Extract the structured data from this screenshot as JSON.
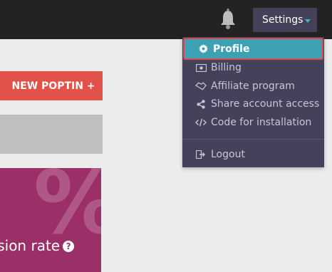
{
  "topbar": {
    "bell_icon": "bell-icon",
    "settings_label": "Settings",
    "accent": "#3bb6c9"
  },
  "dropdown": {
    "items": [
      {
        "label": "Profile",
        "icon": "gear-icon",
        "active": true
      },
      {
        "label": "Billing",
        "icon": "billing-icon"
      },
      {
        "label": "Affiliate program",
        "icon": "handshake-icon"
      },
      {
        "label": "Share account access",
        "icon": "share-icon"
      },
      {
        "label": "Code for installation",
        "icon": "code-icon"
      },
      {
        "label": "Logout",
        "icon": "logout-icon"
      }
    ],
    "highlight_color": "#e0474c"
  },
  "main": {
    "new_poptin_label": "NEW POPTIN +",
    "card": {
      "symbol": "%",
      "label": "rsion rate",
      "help_icon": "?",
      "color": "#9b2f68"
    }
  }
}
